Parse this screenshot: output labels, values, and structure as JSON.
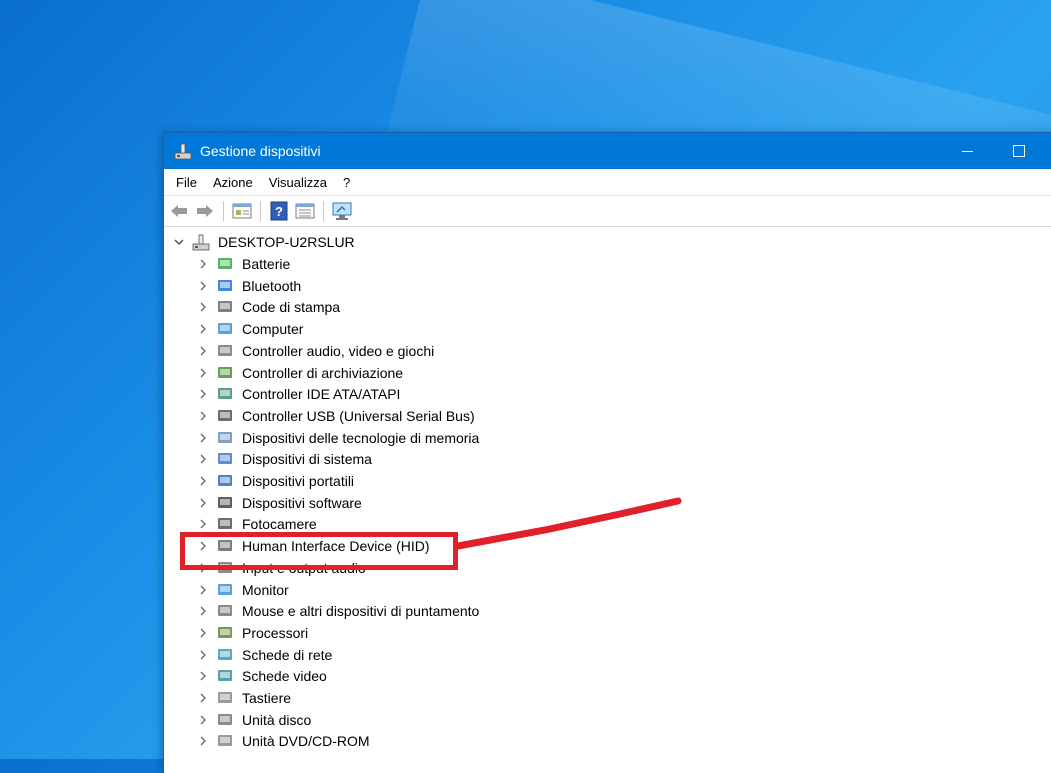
{
  "window": {
    "title": "Gestione dispositivi"
  },
  "menu": {
    "items": [
      "File",
      "Azione",
      "Visualizza",
      "?"
    ]
  },
  "toolbar": {
    "buttons": [
      "back-arrow-icon",
      "forward-arrow-icon",
      "properties-view-icon",
      "help-icon",
      "details-view-icon",
      "monitor-scan-icon"
    ]
  },
  "tree": {
    "root": "DESKTOP-U2RSLUR",
    "items": [
      {
        "label": "Batterie",
        "icon": "battery-icon"
      },
      {
        "label": "Bluetooth",
        "icon": "bluetooth-icon"
      },
      {
        "label": "Code di stampa",
        "icon": "printer-icon"
      },
      {
        "label": "Computer",
        "icon": "computer-icon"
      },
      {
        "label": "Controller audio, video e giochi",
        "icon": "speaker-icon"
      },
      {
        "label": "Controller di archiviazione",
        "icon": "storage-controller-icon"
      },
      {
        "label": "Controller IDE ATA/ATAPI",
        "icon": "ide-controller-icon"
      },
      {
        "label": "Controller USB (Universal Serial Bus)",
        "icon": "usb-icon"
      },
      {
        "label": "Dispositivi delle tecnologie di memoria",
        "icon": "memory-device-icon"
      },
      {
        "label": "Dispositivi di sistema",
        "icon": "system-device-icon"
      },
      {
        "label": "Dispositivi portatili",
        "icon": "portable-device-icon"
      },
      {
        "label": "Dispositivi software",
        "icon": "software-device-icon"
      },
      {
        "label": "Fotocamere",
        "icon": "camera-icon"
      },
      {
        "label": "Human Interface Device (HID)",
        "icon": "hid-icon"
      },
      {
        "label": "Input e output audio",
        "icon": "audio-io-icon"
      },
      {
        "label": "Monitor",
        "icon": "monitor-icon"
      },
      {
        "label": "Mouse e altri dispositivi di puntamento",
        "icon": "mouse-icon"
      },
      {
        "label": "Processori",
        "icon": "processor-icon"
      },
      {
        "label": "Schede di rete",
        "icon": "network-adapter-icon"
      },
      {
        "label": "Schede video",
        "icon": "video-card-icon"
      },
      {
        "label": "Tastiere",
        "icon": "keyboard-icon"
      },
      {
        "label": "Unità disco",
        "icon": "disk-drive-icon"
      },
      {
        "label": "Unità DVD/CD-ROM",
        "icon": "dvd-drive-icon"
      }
    ]
  },
  "annotation": {
    "color": "#e0202a",
    "highlighted": "Human Interface Device (HID)"
  },
  "colors": {
    "titlebar": "#0078d7",
    "desktop": "#1a8ee6"
  }
}
